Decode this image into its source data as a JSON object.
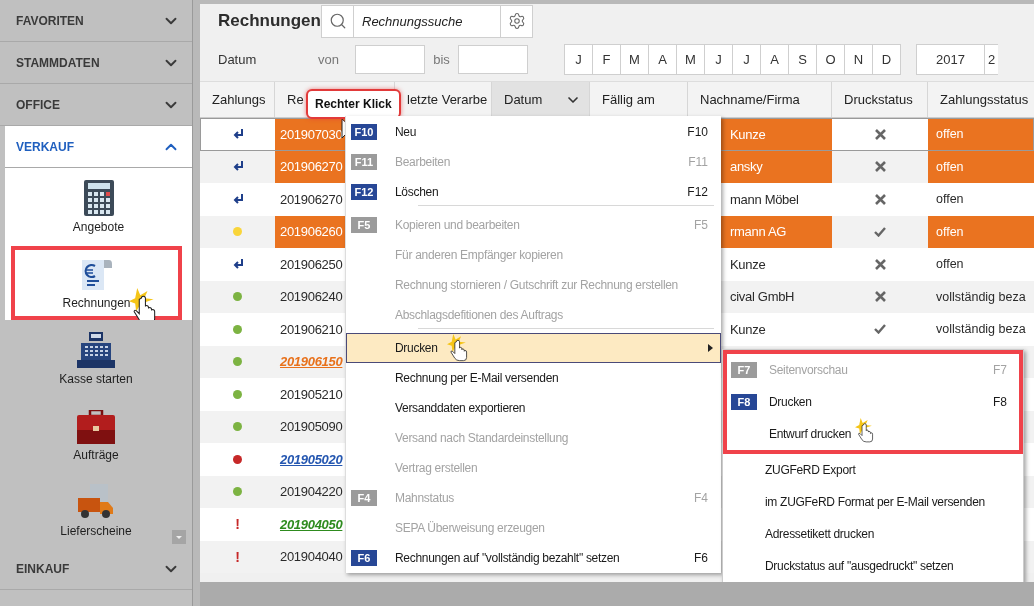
{
  "sidebar": {
    "sections": [
      {
        "label": "FAVORITEN",
        "expanded": false,
        "dimmed": true
      },
      {
        "label": "STAMMDATEN",
        "expanded": false,
        "dimmed": true
      },
      {
        "label": "OFFICE",
        "expanded": false,
        "dimmed": true
      },
      {
        "label": "VERKAUF",
        "expanded": true,
        "dimmed": false,
        "items": [
          {
            "label": "Angebote",
            "kind": "calculator",
            "dimmed": false,
            "marked": false
          },
          {
            "label": "Rechnungen",
            "kind": "invoice",
            "dimmed": false,
            "marked": true
          },
          {
            "label": "Kasse starten",
            "kind": "register",
            "dimmed": true,
            "marked": false
          },
          {
            "label": "Aufträge",
            "kind": "briefcase",
            "dimmed": true,
            "marked": false
          },
          {
            "label": "Lieferscheine",
            "kind": "truck",
            "dimmed": true,
            "marked": false
          }
        ]
      },
      {
        "label": "EINKAUF",
        "expanded": false,
        "dimmed": true
      }
    ]
  },
  "title": "Rechnungen",
  "search": {
    "placeholder": "Rechnungssuche"
  },
  "date_filter": {
    "label": "Datum",
    "from_label": "von",
    "to_label": "bis",
    "months": [
      "J",
      "F",
      "M",
      "A",
      "M",
      "J",
      "J",
      "A",
      "S",
      "O",
      "N",
      "D"
    ],
    "years": [
      "2017",
      "2"
    ]
  },
  "table": {
    "columns": [
      {
        "label": "Zahlungs",
        "sorted": false
      },
      {
        "label": "Re",
        "sorted": false
      },
      {
        "label": "letzte Verarbe",
        "sorted": false
      },
      {
        "label": "Datum",
        "sorted": true
      },
      {
        "label": "Fällig am",
        "sorted": false
      },
      {
        "label": "Nachname/Firma",
        "sorted": false
      },
      {
        "label": "Druckstatus",
        "sorted": false
      },
      {
        "label": "Zahlungsstatus",
        "sorted": false
      }
    ],
    "rows": [
      {
        "status": {
          "kind": "return"
        },
        "number": {
          "text": "201907030",
          "link": false
        },
        "highlighted": true,
        "selected": true,
        "name": "Kunze",
        "printed": false,
        "payment": "offen"
      },
      {
        "status": {
          "kind": "return"
        },
        "number": {
          "text": "201906270",
          "link": false
        },
        "highlighted": true,
        "selected": false,
        "name": "ansky",
        "printed": false,
        "payment": "offen"
      },
      {
        "status": {
          "kind": "return"
        },
        "number": {
          "text": "201906270",
          "link": false
        },
        "highlighted": false,
        "selected": false,
        "name": "mann Möbel",
        "printed": false,
        "payment": "offen"
      },
      {
        "status": {
          "kind": "dot",
          "color": "#f9d53a"
        },
        "number": {
          "text": "201906260",
          "link": false
        },
        "highlighted": true,
        "selected": false,
        "name": "rmann AG",
        "printed": true,
        "payment": "offen"
      },
      {
        "status": {
          "kind": "return"
        },
        "number": {
          "text": "201906250",
          "link": false
        },
        "highlighted": false,
        "selected": false,
        "name": "Kunze",
        "printed": false,
        "payment": "offen"
      },
      {
        "status": {
          "kind": "dot",
          "color": "#7cb342"
        },
        "number": {
          "text": "201906240",
          "link": false
        },
        "highlighted": false,
        "selected": false,
        "name": "cival GmbH",
        "printed": false,
        "payment": "vollständig beza"
      },
      {
        "status": {
          "kind": "dot",
          "color": "#7cb342"
        },
        "number": {
          "text": "201906210",
          "link": false
        },
        "highlighted": false,
        "selected": false,
        "name": "Kunze",
        "printed": true,
        "payment": "vollständig beza"
      },
      {
        "status": {
          "kind": "dot",
          "color": "#7cb342"
        },
        "number": {
          "text": "201906150",
          "link": true,
          "color": "#e8711b"
        },
        "highlighted": false,
        "selected": false
      },
      {
        "status": {
          "kind": "dot",
          "color": "#7cb342"
        },
        "number": {
          "text": "201905210",
          "link": false
        },
        "highlighted": false,
        "selected": false
      },
      {
        "status": {
          "kind": "dot",
          "color": "#7cb342"
        },
        "number": {
          "text": "201905090",
          "link": false
        },
        "highlighted": false,
        "selected": false
      },
      {
        "status": {
          "kind": "dot",
          "color": "#c62828"
        },
        "number": {
          "text": "201905020",
          "link": true,
          "color": "#2456b0"
        },
        "highlighted": false,
        "selected": false
      },
      {
        "status": {
          "kind": "dot",
          "color": "#7cb342"
        },
        "number": {
          "text": "201904220",
          "link": false
        },
        "highlighted": false,
        "selected": false
      },
      {
        "status": {
          "kind": "alert",
          "symbol": "!"
        },
        "number": {
          "text": "201904050",
          "link": true,
          "color": "#2e8b1e"
        },
        "highlighted": false,
        "selected": false
      },
      {
        "status": {
          "kind": "alert",
          "symbol": "!"
        },
        "number": {
          "text": "201904040",
          "link": false
        },
        "highlighted": false,
        "selected": false
      }
    ]
  },
  "tooltip": {
    "text": "Rechter Klick"
  },
  "context_menu": {
    "items": [
      {
        "badge": "F10",
        "label": "Neu",
        "shortcut": "F10",
        "disabled": false,
        "separator_after": false,
        "submenu": false,
        "hovered": false
      },
      {
        "badge": "F11",
        "label": "Bearbeiten",
        "shortcut": "F11",
        "disabled": true,
        "separator_after": false,
        "submenu": false,
        "hovered": false
      },
      {
        "badge": "F12",
        "label": "Löschen",
        "shortcut": "F12",
        "disabled": false,
        "separator_after": true,
        "submenu": false,
        "hovered": false
      },
      {
        "badge": "F5",
        "label": "Kopieren und bearbeiten",
        "shortcut": "F5",
        "disabled": true,
        "separator_after": false,
        "submenu": false,
        "hovered": false
      },
      {
        "label": "Für anderen Empfänger kopieren",
        "disabled": true,
        "separator_after": false,
        "submenu": false,
        "hovered": false
      },
      {
        "label": "Rechnung stornieren / Gutschrift zur Rechnung erstellen",
        "disabled": true,
        "separator_after": false,
        "submenu": false,
        "hovered": false
      },
      {
        "label": "Abschlagsdefitionen des Auftrags",
        "disabled": true,
        "separator_after": true,
        "submenu": false,
        "hovered": false
      },
      {
        "label": "Drucken",
        "disabled": false,
        "separator_after": false,
        "submenu": true,
        "hovered": true
      },
      {
        "label": "Rechnung per E-Mail versenden",
        "disabled": false,
        "separator_after": false,
        "submenu": false,
        "hovered": false
      },
      {
        "label": "Versanddaten exportieren",
        "disabled": false,
        "separator_after": false,
        "submenu": false,
        "hovered": false
      },
      {
        "label": "Versand nach Standardeinstellung",
        "disabled": true,
        "separator_after": false,
        "submenu": false,
        "hovered": false
      },
      {
        "label": "Vertrag erstellen",
        "disabled": true,
        "separator_after": false,
        "submenu": false,
        "hovered": false
      },
      {
        "badge": "F4",
        "label": "Mahnstatus",
        "shortcut": "F4",
        "disabled": true,
        "separator_after": false,
        "submenu": false,
        "hovered": false
      },
      {
        "label": "SEPA Überweisung erzeugen",
        "disabled": true,
        "separator_after": false,
        "submenu": false,
        "hovered": false
      },
      {
        "badge": "F6",
        "label": "Rechnungen auf \"vollständig bezahlt\" setzen",
        "shortcut": "F6",
        "disabled": false,
        "separator_after": false,
        "submenu": false,
        "hovered": false
      }
    ]
  },
  "submenu": {
    "marked_items": [
      {
        "badge": "F7",
        "label": "Seitenvorschau",
        "shortcut": "F7",
        "disabled": true
      },
      {
        "badge": "F8",
        "label": "Drucken",
        "shortcut": "F8",
        "disabled": false
      },
      {
        "label": "Entwurf drucken",
        "disabled": false
      }
    ],
    "items": [
      {
        "label": "ZUGFeRD Export",
        "disabled": false
      },
      {
        "label": "im ZUGFeRD Format per E-Mail versenden",
        "disabled": false
      },
      {
        "label": "Adressetikett drucken",
        "disabled": false
      },
      {
        "label": "Druckstatus auf \"ausgedruckt\" setzen",
        "disabled": false
      }
    ]
  }
}
